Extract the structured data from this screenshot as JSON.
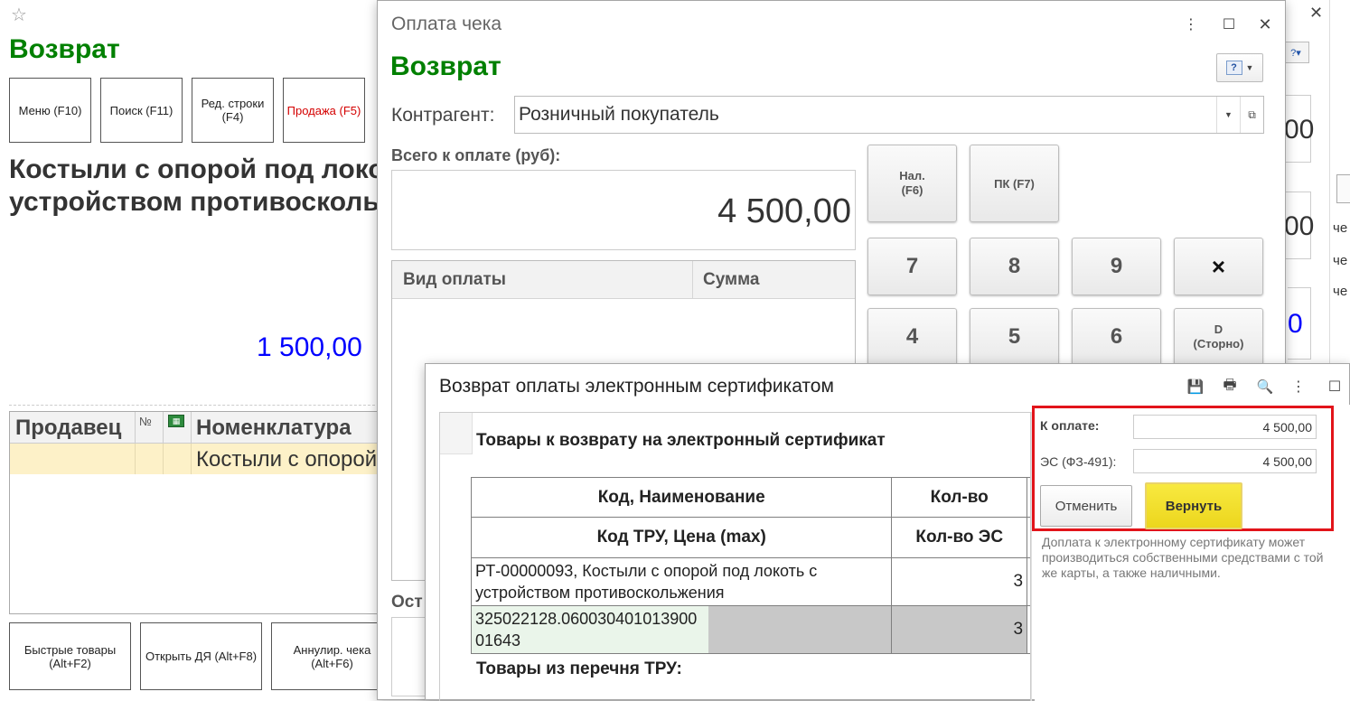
{
  "bg": {
    "title": "Возврат",
    "buttons": [
      "Меню (F10)",
      "Поиск (F11)",
      "Ред. строки (F4)",
      "Продажа (F5)"
    ],
    "product_name": "Костыли с опорой под локоть с устройством противоскольжения",
    "amount": "1 500,00",
    "table": {
      "headers": [
        "Продавец",
        "№",
        "",
        "Номенклатура"
      ],
      "row_item": "Костыли с опорой под локоть с устройством противоскольжения"
    },
    "bottom_buttons": [
      "Быстрые товары (Alt+F2)",
      "Открыть ДЯ (Alt+F8)",
      "Аннулир. чека (Alt+F6)"
    ],
    "right_fragments": [
      "00",
      "00",
      "че",
      "че",
      "че",
      "0"
    ]
  },
  "payment": {
    "window_title": "Оплата чека",
    "title": "Возврат",
    "kontragent_label": "Контрагент:",
    "kontragent_value": "Розничный покупатель",
    "total_label": "Всего к оплате (руб):",
    "total_value": "4 500,00",
    "grid_headers": [
      "Вид оплаты",
      "Сумма"
    ],
    "ost_label": "Ост",
    "pay_buttons": [
      "Нал. (F6)",
      "ПК (F7)"
    ],
    "keys": [
      "7",
      "8",
      "9",
      "×",
      "4",
      "5",
      "6",
      "D (Сторно)"
    ]
  },
  "cert": {
    "window_title": "Возврат оплаты электронным сертификатом",
    "section_title": "Товары к возврату на электронный сертификат",
    "columns_row1": [
      "Код, Наименование",
      "Кол-во"
    ],
    "columns_row2": [
      "Код ТРУ, Цена (max)",
      "Кол-во ЭС"
    ],
    "rows": [
      {
        "name": "РТ-00000093, Костыли с опорой под локоть с устройством противоскольжения",
        "qty": "3"
      },
      {
        "name": "325022128.06003040101390001643",
        "qty": "3"
      }
    ],
    "section2_title": "Товары из перечня ТРУ:",
    "k_oplate_label": "К оплате:",
    "k_oplate_value": "4 500,00",
    "es_label": "ЭС (ФЗ-491):",
    "es_value": "4 500,00",
    "cancel_label": "Отменить",
    "return_label": "Вернуть",
    "note": "Доплата к электронному сертификату может производиться собственными средствами с той же карты, а также наличными."
  },
  "colors": {
    "green": "#008000",
    "blue": "#0000ff",
    "red": "#d40000",
    "highlight": "#fdf1c8",
    "yellow": "#f5e12b"
  }
}
